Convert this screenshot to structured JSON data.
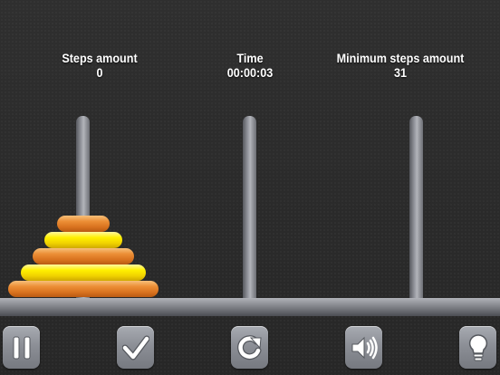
{
  "stats": {
    "steps": {
      "label": "Steps amount",
      "value": "0"
    },
    "time": {
      "label": "Time",
      "value": "00:00:03"
    },
    "min_steps": {
      "label": "Minimum steps amount",
      "value": "31"
    }
  },
  "game": {
    "pegs": 3,
    "disks_on_peg": [
      [
        "orange",
        "yellow",
        "orange",
        "yellow",
        "orange"
      ],
      [],
      []
    ]
  },
  "toolbar": {
    "pause": {
      "icon": "pause-icon"
    },
    "check": {
      "icon": "checkmark-icon"
    },
    "restart": {
      "icon": "restart-icon"
    },
    "sound": {
      "icon": "speaker-icon"
    },
    "hint": {
      "icon": "lightbulb-icon"
    }
  },
  "colors": {
    "background": "#2b2b2b",
    "disk_orange": "#e4802c",
    "disk_yellow": "#ffe800",
    "peg": "#8f9197",
    "button": "#8c8f96"
  }
}
